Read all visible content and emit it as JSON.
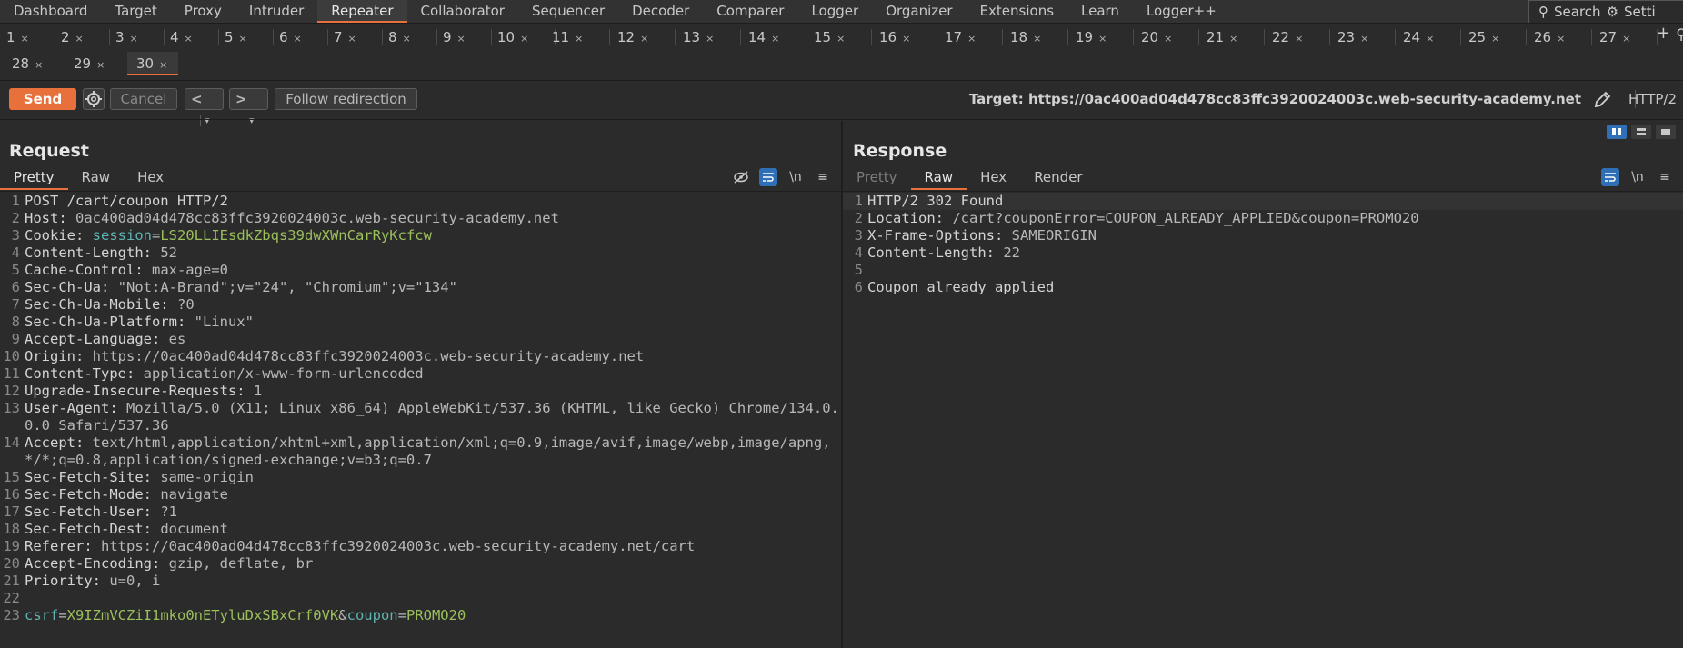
{
  "nav": {
    "items": [
      "Dashboard",
      "Target",
      "Proxy",
      "Intruder",
      "Repeater",
      "Collaborator",
      "Sequencer",
      "Decoder",
      "Comparer",
      "Logger",
      "Organizer",
      "Extensions",
      "Learn",
      "Logger++"
    ],
    "active": "Repeater",
    "search_label": "Search",
    "settings_label": "Setti"
  },
  "tabs": {
    "row1": [
      "1",
      "2",
      "3",
      "4",
      "5",
      "6",
      "7",
      "8",
      "9",
      "10",
      "11",
      "12",
      "13",
      "14",
      "15",
      "16",
      "17",
      "18",
      "19",
      "20",
      "21",
      "22",
      "23",
      "24",
      "25",
      "26",
      "27"
    ],
    "row2": [
      "28",
      "29",
      "30"
    ],
    "active": "30",
    "close_glyph": "×",
    "add_glyph": "+"
  },
  "toolbar": {
    "send_label": "Send",
    "cancel_label": "Cancel",
    "back_label": "<",
    "forward_label": ">",
    "dropdown_glyph": "▾",
    "follow_label": "Follow redirection",
    "target_text": "Target: https://0ac400ad04d478cc83ffc3920024003c.web-security-academy.net",
    "protocol": "HTTP/2"
  },
  "request": {
    "title": "Request",
    "tabs": [
      "Pretty",
      "Raw",
      "Hex"
    ],
    "active_tab": "Pretty",
    "newline_label": "\\n",
    "lines": [
      {
        "n": "1",
        "parts": [
          [
            "t",
            "POST /cart/coupon HTTP/2"
          ]
        ]
      },
      {
        "n": "2",
        "parts": [
          [
            "h",
            "Host: "
          ],
          [
            "v",
            "0ac400ad04d478cc83ffc3920024003c.web-security-academy.net"
          ]
        ]
      },
      {
        "n": "3",
        "parts": [
          [
            "h",
            "Cookie: "
          ],
          [
            "c",
            "session"
          ],
          [
            "v",
            "="
          ],
          [
            "g",
            "LS20LLIEsdkZbqs39dwXWnCarRyKcfcw"
          ]
        ]
      },
      {
        "n": "4",
        "parts": [
          [
            "h",
            "Content-Length: "
          ],
          [
            "v",
            "52"
          ]
        ]
      },
      {
        "n": "5",
        "parts": [
          [
            "h",
            "Cache-Control: "
          ],
          [
            "v",
            "max-age=0"
          ]
        ]
      },
      {
        "n": "6",
        "parts": [
          [
            "h",
            "Sec-Ch-Ua: "
          ],
          [
            "v",
            "\"Not:A-Brand\";v=\"24\", \"Chromium\";v=\"134\""
          ]
        ]
      },
      {
        "n": "7",
        "parts": [
          [
            "h",
            "Sec-Ch-Ua-Mobile: "
          ],
          [
            "v",
            "?0"
          ]
        ]
      },
      {
        "n": "8",
        "parts": [
          [
            "h",
            "Sec-Ch-Ua-Platform: "
          ],
          [
            "v",
            "\"Linux\""
          ]
        ]
      },
      {
        "n": "9",
        "parts": [
          [
            "h",
            "Accept-Language: "
          ],
          [
            "v",
            "es"
          ]
        ]
      },
      {
        "n": "10",
        "parts": [
          [
            "h",
            "Origin: "
          ],
          [
            "v",
            "https://0ac400ad04d478cc83ffc3920024003c.web-security-academy.net"
          ]
        ]
      },
      {
        "n": "11",
        "parts": [
          [
            "h",
            "Content-Type: "
          ],
          [
            "v",
            "application/x-www-form-urlencoded"
          ]
        ]
      },
      {
        "n": "12",
        "parts": [
          [
            "h",
            "Upgrade-Insecure-Requests: "
          ],
          [
            "v",
            "1"
          ]
        ]
      },
      {
        "n": "13",
        "parts": [
          [
            "h",
            "User-Agent: "
          ],
          [
            "v",
            "Mozilla/5.0 (X11; Linux x86_64) AppleWebKit/537.36 (KHTML, like Gecko) Chrome/134.0.0.0 Safari/537.36"
          ]
        ]
      },
      {
        "n": "14",
        "parts": [
          [
            "h",
            "Accept: "
          ],
          [
            "v",
            "text/html,application/xhtml+xml,application/xml;q=0.9,image/avif,image/webp,image/apng,*/*;q=0.8,application/signed-exchange;v=b3;q=0.7"
          ]
        ]
      },
      {
        "n": "15",
        "parts": [
          [
            "h",
            "Sec-Fetch-Site: "
          ],
          [
            "v",
            "same-origin"
          ]
        ]
      },
      {
        "n": "16",
        "parts": [
          [
            "h",
            "Sec-Fetch-Mode: "
          ],
          [
            "v",
            "navigate"
          ]
        ]
      },
      {
        "n": "17",
        "parts": [
          [
            "h",
            "Sec-Fetch-User: "
          ],
          [
            "v",
            "?1"
          ]
        ]
      },
      {
        "n": "18",
        "parts": [
          [
            "h",
            "Sec-Fetch-Dest: "
          ],
          [
            "v",
            "document"
          ]
        ]
      },
      {
        "n": "19",
        "parts": [
          [
            "h",
            "Referer: "
          ],
          [
            "v",
            "https://0ac400ad04d478cc83ffc3920024003c.web-security-academy.net/cart"
          ]
        ]
      },
      {
        "n": "20",
        "parts": [
          [
            "h",
            "Accept-Encoding: "
          ],
          [
            "v",
            "gzip, deflate, br"
          ]
        ]
      },
      {
        "n": "21",
        "parts": [
          [
            "h",
            "Priority: "
          ],
          [
            "v",
            "u=0, i"
          ]
        ]
      },
      {
        "n": "22",
        "parts": [
          [
            "t",
            ""
          ]
        ]
      },
      {
        "n": "23",
        "parts": [
          [
            "c",
            "csrf"
          ],
          [
            "v",
            "="
          ],
          [
            "g",
            "X9IZmVCZiI1mko0nETyluDxSBxCrf0VK"
          ],
          [
            "v",
            "&"
          ],
          [
            "c",
            "coupon"
          ],
          [
            "v",
            "="
          ],
          [
            "g",
            "PROMO20"
          ]
        ]
      }
    ]
  },
  "response": {
    "title": "Response",
    "tabs": [
      "Pretty",
      "Raw",
      "Hex",
      "Render"
    ],
    "active_tab": "Raw",
    "newline_label": "\\n",
    "lines": [
      {
        "n": "1",
        "parts": [
          [
            "t",
            "HTTP/2 302 Found"
          ]
        ]
      },
      {
        "n": "2",
        "parts": [
          [
            "h",
            "Location: "
          ],
          [
            "v",
            "/cart?couponError=COUPON_ALREADY_APPLIED&coupon=PROMO20"
          ]
        ]
      },
      {
        "n": "3",
        "parts": [
          [
            "h",
            "X-Frame-Options: "
          ],
          [
            "v",
            "SAMEORIGIN"
          ]
        ]
      },
      {
        "n": "4",
        "parts": [
          [
            "h",
            "Content-Length: "
          ],
          [
            "v",
            "22"
          ]
        ]
      },
      {
        "n": "5",
        "parts": [
          [
            "t",
            ""
          ]
        ]
      },
      {
        "n": "6",
        "parts": [
          [
            "t",
            "Coupon already applied"
          ]
        ]
      }
    ]
  },
  "colors": {
    "accent": "#e8703a",
    "toggle_on": "#2f6fb5",
    "param_value": "#9bbf5b",
    "param_name": "#5fb3b3"
  }
}
